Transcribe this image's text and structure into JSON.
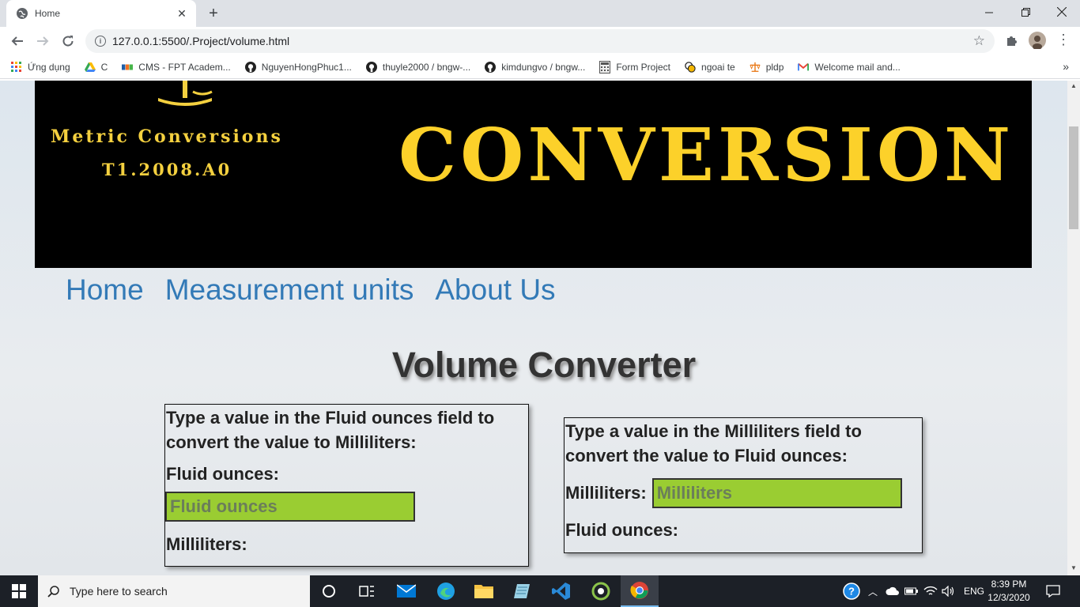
{
  "browser": {
    "tab_title": "Home",
    "new_tab_glyph": "+",
    "url": "127.0.0.1:5500/.Project/volume.html",
    "bookmarks": [
      {
        "label": "Ứng dụng",
        "icon": "apps-grid-icon"
      },
      {
        "label": "C",
        "icon": "google-drive-icon"
      },
      {
        "label": "CMS - FPT Academ...",
        "icon": "fpt-icon"
      },
      {
        "label": "NguyenHongPhuc1...",
        "icon": "github-icon"
      },
      {
        "label": "thuyle2000 / bngw-...",
        "icon": "github-icon"
      },
      {
        "label": "kimdungvo / bngw...",
        "icon": "github-icon"
      },
      {
        "label": "Form Project",
        "icon": "calculator-icon"
      },
      {
        "label": "ngoai te",
        "icon": "currency-icon"
      },
      {
        "label": "pldp",
        "icon": "scale-icon"
      },
      {
        "label": "Welcome mail and...",
        "icon": "gmail-icon"
      }
    ]
  },
  "page": {
    "banner": {
      "subtitle": "Metric Conversions",
      "code": "T1.2008.A0",
      "headline": "CONVERSION"
    },
    "nav": [
      "Home",
      "Measurement units",
      "About Us"
    ],
    "title": "Volume Converter",
    "card_oz_to_ml": {
      "description": "Type a value in the Fluid ounces field to convert the value to Milliliters:",
      "input_label": "Fluid ounces:",
      "input_placeholder": "Fluid ounces",
      "output_label": "Milliliters:"
    },
    "card_ml_to_oz": {
      "description": "Type a value in the Milliliters field to convert the value to Fluid ounces:",
      "input_label": "Milliliters:",
      "input_placeholder": "Milliliters",
      "output_label": "Fluid ounces:"
    }
  },
  "taskbar": {
    "search_placeholder": "Type here to search",
    "language": "ENG",
    "time": "8:39 PM",
    "date": "12/3/2020"
  },
  "colors": {
    "banner_text": "#fcd12a",
    "nav_link": "#337ab7",
    "field_bg": "#9acd32"
  }
}
